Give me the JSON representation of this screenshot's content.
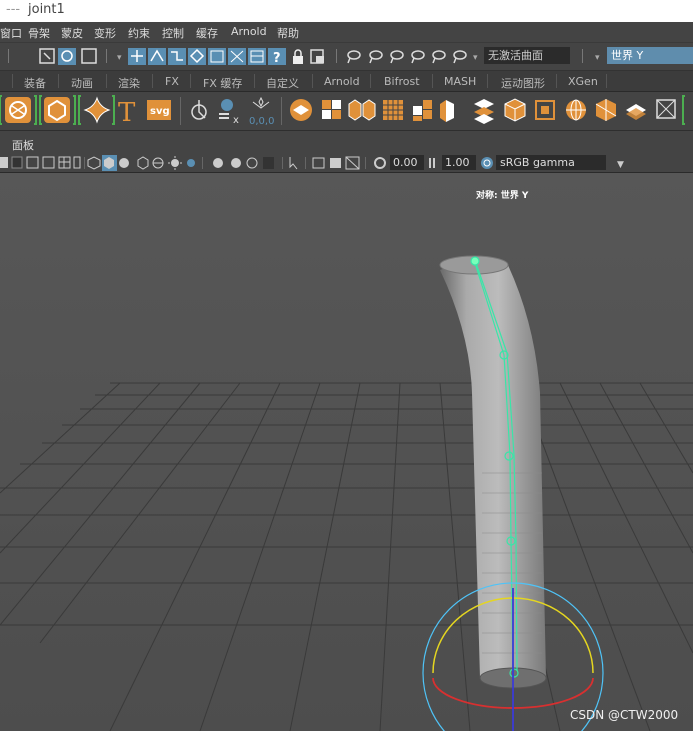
{
  "window": {
    "dash": "---",
    "title": "joint1"
  },
  "menu": [
    "窗口",
    "骨架",
    "蒙皮",
    "变形",
    "约束",
    "控制",
    "缓存",
    "Arnold",
    "帮助"
  ],
  "status_line": {
    "surface_field": "无激活曲面",
    "axis_field": "世界 Y"
  },
  "shelf_tabs": [
    "装备",
    "动画",
    "渲染",
    "FX",
    "FX 缓存",
    "自定义",
    "Arnold",
    "Bifrost",
    "MASH",
    "运动图形",
    "XGen"
  ],
  "shelf": {
    "text_tool_glyph": "T",
    "svg_label": "svg",
    "origin_label": "0,0,0"
  },
  "panel": {
    "menu_label": "面板",
    "exposure_value": "0.00",
    "gamma_value": "1.00",
    "color_space": "sRGB gamma"
  },
  "viewport": {
    "hud_label": "对称: 世界 Y",
    "watermark": "CSDN @CTW2000"
  }
}
